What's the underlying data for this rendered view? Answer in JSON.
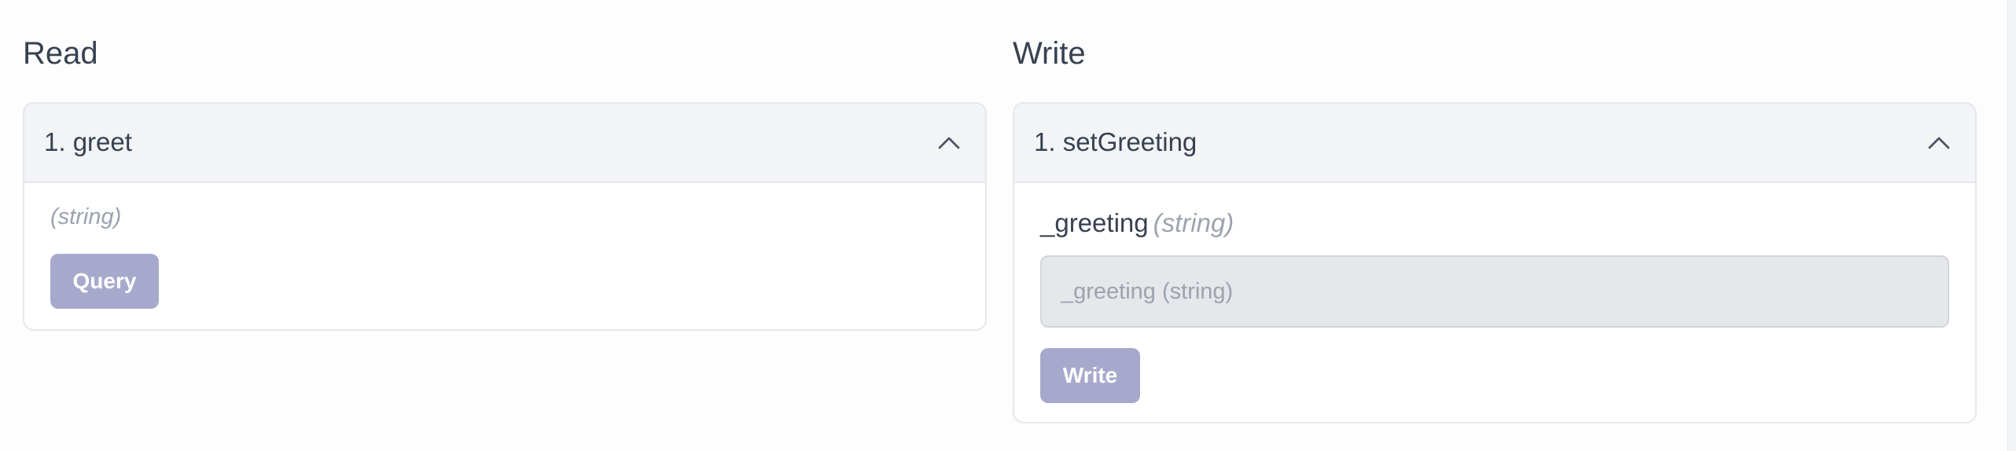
{
  "read": {
    "title": "Read",
    "functions": [
      {
        "header": "1. greet",
        "output_type": "(string)",
        "button_label": "Query"
      }
    ]
  },
  "write": {
    "title": "Write",
    "functions": [
      {
        "header": "1. setGreeting",
        "arg_name": "_greeting",
        "arg_type": "(string)",
        "input_placeholder": "_greeting (string)",
        "input_value": "",
        "button_label": "Write"
      }
    ]
  },
  "icons": {
    "collapse": "chevron-up-icon"
  },
  "colors": {
    "button_bg": "#a7a9cc",
    "header_bg": "#f3f4f6",
    "border": "#e5e7eb"
  }
}
